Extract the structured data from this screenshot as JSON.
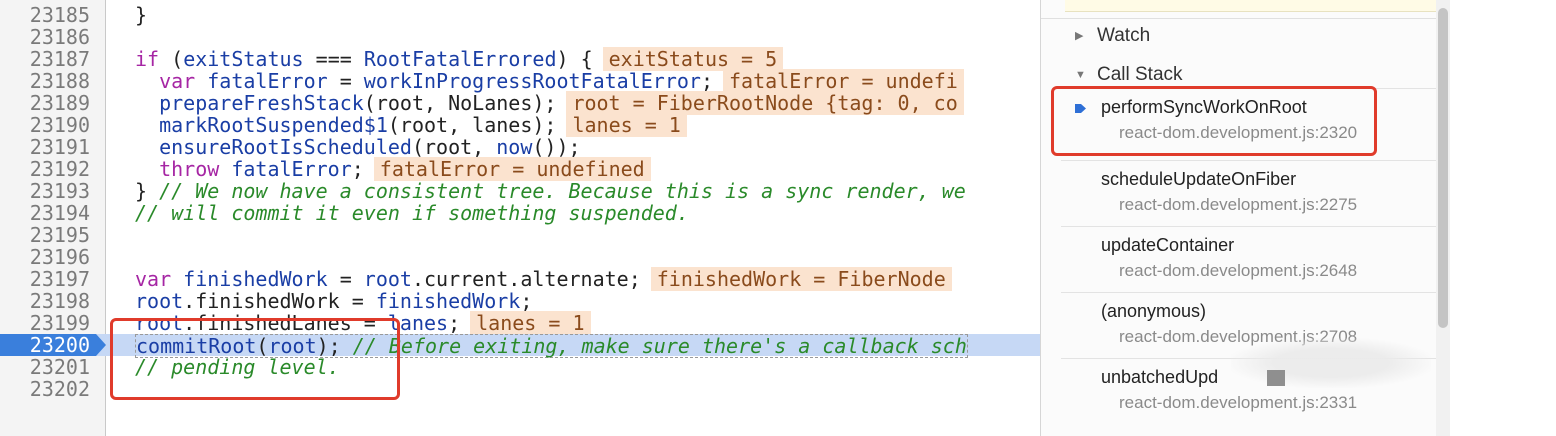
{
  "code": {
    "lines": [
      {
        "num": "23185",
        "parts": [
          {
            "t": "}",
            "c": "pl"
          }
        ]
      },
      {
        "num": "23186",
        "parts": []
      },
      {
        "num": "23187",
        "parts": [
          {
            "t": "if",
            "c": "kw"
          },
          {
            "t": " (",
            "c": "pl"
          },
          {
            "t": "exitStatus",
            "c": "var"
          },
          {
            "t": " === ",
            "c": "pl"
          },
          {
            "t": "RootFatalErrored",
            "c": "var"
          },
          {
            "t": ") {",
            "c": "pl"
          },
          {
            "t": "exitStatus = 5",
            "c": "inl"
          }
        ]
      },
      {
        "num": "23188",
        "parts": [
          {
            "t": "  var",
            "c": "kw"
          },
          {
            "t": " fatalError",
            "c": "var"
          },
          {
            "t": " = ",
            "c": "pl"
          },
          {
            "t": "workInProgressRootFatalError",
            "c": "var"
          },
          {
            "t": ";",
            "c": "pl"
          },
          {
            "t": "fatalError = undefi",
            "c": "inl"
          }
        ]
      },
      {
        "num": "23189",
        "parts": [
          {
            "t": "  prepareFreshStack",
            "c": "fn"
          },
          {
            "t": "(root, NoLanes);",
            "c": "pl"
          },
          {
            "t": "root = FiberRootNode {tag: 0, co",
            "c": "inl"
          }
        ]
      },
      {
        "num": "23190",
        "parts": [
          {
            "t": "  markRootSuspended$1",
            "c": "fn"
          },
          {
            "t": "(root, lanes);",
            "c": "pl"
          },
          {
            "t": "lanes = 1",
            "c": "inl"
          }
        ]
      },
      {
        "num": "23191",
        "parts": [
          {
            "t": "  ensureRootIsScheduled",
            "c": "fn"
          },
          {
            "t": "(root, ",
            "c": "pl"
          },
          {
            "t": "now",
            "c": "fn"
          },
          {
            "t": "());",
            "c": "pl"
          }
        ]
      },
      {
        "num": "23192",
        "parts": [
          {
            "t": "  throw",
            "c": "kw"
          },
          {
            "t": " fatalError",
            "c": "var"
          },
          {
            "t": ";",
            "c": "pl"
          },
          {
            "t": "fatalError = undefined",
            "c": "inl"
          }
        ]
      },
      {
        "num": "23193",
        "parts": [
          {
            "t": "} ",
            "c": "pl"
          },
          {
            "t": "// We now have a consistent tree. Because this is a sync render, we",
            "c": "cm"
          }
        ]
      },
      {
        "num": "23194",
        "parts": [
          {
            "t": "// will commit it even if something suspended.",
            "c": "cm"
          }
        ]
      },
      {
        "num": "23195",
        "parts": []
      },
      {
        "num": "23196",
        "parts": []
      },
      {
        "num": "23197",
        "parts": [
          {
            "t": "var",
            "c": "kw"
          },
          {
            "t": " finishedWork",
            "c": "var"
          },
          {
            "t": " = ",
            "c": "pl"
          },
          {
            "t": "root",
            "c": "var"
          },
          {
            "t": ".current.alternate;",
            "c": "pl"
          },
          {
            "t": "finishedWork = FiberNode",
            "c": "inl"
          }
        ]
      },
      {
        "num": "23198",
        "parts": [
          {
            "t": "root",
            "c": "var"
          },
          {
            "t": ".finishedWork = ",
            "c": "pl"
          },
          {
            "t": "finishedWork",
            "c": "var"
          },
          {
            "t": ";",
            "c": "pl"
          }
        ]
      },
      {
        "num": "23199",
        "parts": [
          {
            "t": "root",
            "c": "var"
          },
          {
            "t": ".finishedLanes = ",
            "c": "pl"
          },
          {
            "t": "lanes",
            "c": "var"
          },
          {
            "t": ";",
            "c": "pl"
          },
          {
            "t": "lanes = 1",
            "c": "inl"
          }
        ]
      },
      {
        "num": "23200",
        "current": true,
        "parts": [
          {
            "t": "commitRoot",
            "c": "fn"
          },
          {
            "t": "(",
            "c": "pl"
          },
          {
            "t": "root",
            "c": "var"
          },
          {
            "t": "); ",
            "c": "pl"
          },
          {
            "t": "// Before exiting, make sure there's a callback sch",
            "c": "cm"
          }
        ]
      },
      {
        "num": "23201",
        "parts": [
          {
            "t": "// pending level.",
            "c": "cm"
          }
        ]
      },
      {
        "num": "23202",
        "parts": []
      }
    ]
  },
  "side_panel": {
    "watch_label": "Watch",
    "callstack_label": "Call Stack",
    "frames": [
      {
        "name": "performSyncWorkOnRoot",
        "location": "react-dom.development.js:2320",
        "active": true
      },
      {
        "name": "scheduleUpdateOnFiber",
        "location": "react-dom.development.js:2275"
      },
      {
        "name": "updateContainer",
        "location": "react-dom.development.js:2648"
      },
      {
        "name": "(anonymous)",
        "location": "react-dom.development.js:2708"
      },
      {
        "name": "unbatchedUpd",
        "location": "react-dom.development.js:2331"
      }
    ]
  },
  "colors": {
    "current_line_bg": "#c6d8f5",
    "annotation_red": "#e03b2b",
    "active_frame_arrow": "#2e6fd6"
  }
}
